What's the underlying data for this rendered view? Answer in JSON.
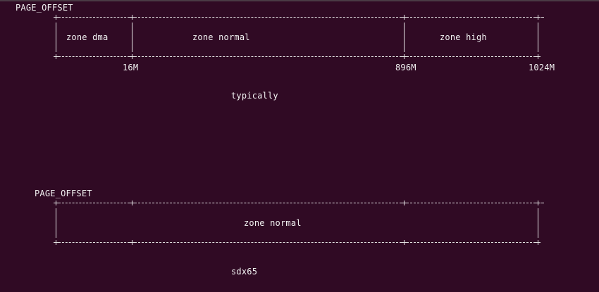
{
  "terminal": {
    "background_color": "#300a24",
    "text_color": "#f2f2f2"
  },
  "diagram_typical": {
    "page_offset_label": "PAGE_OFFSET",
    "zones": [
      "zone dma",
      "zone normal",
      "zone high"
    ],
    "boundaries": [
      "16M",
      "896M",
      "1024M"
    ],
    "caption": "typically"
  },
  "diagram_sdx65": {
    "page_offset_label": "PAGE_OFFSET",
    "zones": [
      "zone normal"
    ],
    "caption": "sdx65"
  }
}
